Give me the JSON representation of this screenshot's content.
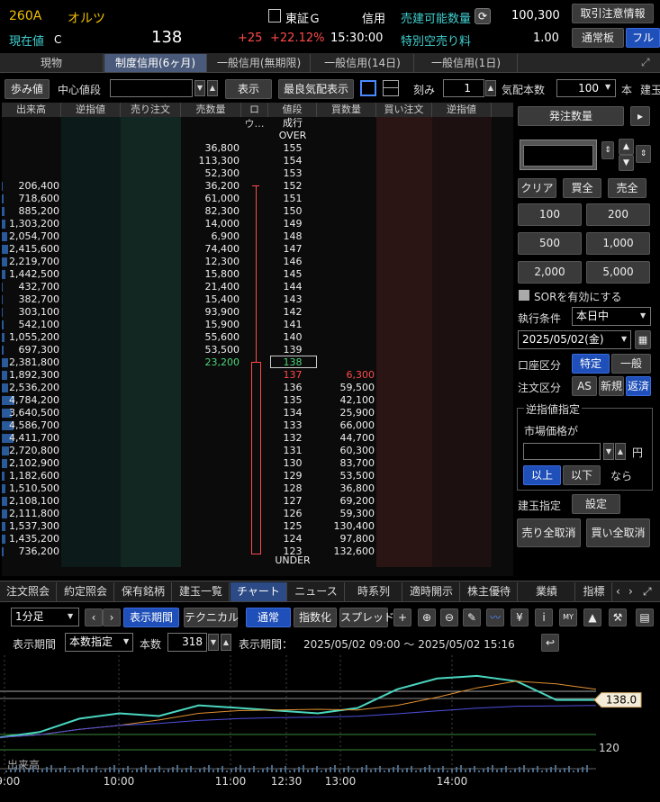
{
  "header": {
    "code": "260A",
    "name": "オルツ",
    "current_label": "現在値",
    "c_mark": "C",
    "price": "138",
    "change": "+25",
    "change_pct": "+22.12%",
    "time": "15:30:00",
    "exchange": "東証Ｇ",
    "credit": "信用",
    "sellable_label": "売建可能数量",
    "sellable_value": "100,300",
    "short_fee_label": "特別空売り料",
    "short_fee_value": "1.00",
    "notice_button": "取引注意情報",
    "normal_button": "通常板",
    "full_button": "フル"
  },
  "top_tabs": [
    "現物",
    "制度信用(6ヶ月)",
    "一般信用(無期限)",
    "一般信用(14日)",
    "一般信用(1日)"
  ],
  "toolbar": {
    "ayumi": "歩み値",
    "center_label": "中心値段",
    "center_value": "",
    "display": "表示",
    "best": "最良気配表示",
    "tick_label": "刻み",
    "tick_value": "1",
    "quote_label": "気配本数",
    "quote_value": "100",
    "unit": "本",
    "build": "建玉"
  },
  "board": {
    "headers": [
      "出来高",
      "逆指値",
      "売り注文",
      "売数量",
      "ロウ…",
      "値段",
      "買数量",
      "買い注文",
      "逆指値"
    ],
    "top_labels": [
      "成行",
      "OVER"
    ],
    "bottom_label": "UNDER",
    "rows": [
      {
        "vol": "",
        "ask": "36,800",
        "price": "155",
        "bid": ""
      },
      {
        "vol": "",
        "ask": "113,300",
        "price": "154",
        "bid": ""
      },
      {
        "vol": "",
        "ask": "52,300",
        "price": "153",
        "bid": ""
      },
      {
        "vol": "206,400",
        "ask": "36,200",
        "price": "152",
        "bid": ""
      },
      {
        "vol": "718,600",
        "ask": "61,000",
        "price": "151",
        "bid": ""
      },
      {
        "vol": "885,200",
        "ask": "82,300",
        "price": "150",
        "bid": ""
      },
      {
        "vol": "1,303,200",
        "ask": "14,000",
        "price": "149",
        "bid": ""
      },
      {
        "vol": "2,054,700",
        "ask": "6,900",
        "price": "148",
        "bid": ""
      },
      {
        "vol": "2,415,600",
        "ask": "74,400",
        "price": "147",
        "bid": ""
      },
      {
        "vol": "2,219,700",
        "ask": "12,300",
        "price": "146",
        "bid": ""
      },
      {
        "vol": "1,442,500",
        "ask": "15,800",
        "price": "145",
        "bid": ""
      },
      {
        "vol": "432,700",
        "ask": "21,400",
        "price": "144",
        "bid": ""
      },
      {
        "vol": "382,700",
        "ask": "15,400",
        "price": "143",
        "bid": ""
      },
      {
        "vol": "303,100",
        "ask": "93,900",
        "price": "142",
        "bid": ""
      },
      {
        "vol": "542,100",
        "ask": "15,900",
        "price": "141",
        "bid": ""
      },
      {
        "vol": "1,055,200",
        "ask": "55,600",
        "price": "140",
        "bid": ""
      },
      {
        "vol": "697,300",
        "ask": "53,500",
        "price": "139",
        "bid": ""
      },
      {
        "vol": "2,381,800",
        "ask": "23,200",
        "price": "138",
        "bid": ""
      },
      {
        "vol": "1,892,300",
        "ask": "",
        "price": "137",
        "bid": "6,300"
      },
      {
        "vol": "2,536,200",
        "ask": "",
        "price": "136",
        "bid": "59,500"
      },
      {
        "vol": "4,784,200",
        "ask": "",
        "price": "135",
        "bid": "42,100"
      },
      {
        "vol": "3,640,500",
        "ask": "",
        "price": "134",
        "bid": "25,900"
      },
      {
        "vol": "4,586,700",
        "ask": "",
        "price": "133",
        "bid": "66,000"
      },
      {
        "vol": "4,411,700",
        "ask": "",
        "price": "132",
        "bid": "44,700"
      },
      {
        "vol": "2,720,800",
        "ask": "",
        "price": "131",
        "bid": "60,300"
      },
      {
        "vol": "2,102,900",
        "ask": "",
        "price": "130",
        "bid": "83,700"
      },
      {
        "vol": "1,182,600",
        "ask": "",
        "price": "129",
        "bid": "53,500"
      },
      {
        "vol": "1,510,500",
        "ask": "",
        "price": "128",
        "bid": "36,800"
      },
      {
        "vol": "2,108,100",
        "ask": "",
        "price": "127",
        "bid": "69,200"
      },
      {
        "vol": "2,111,800",
        "ask": "",
        "price": "126",
        "bid": "59,300"
      },
      {
        "vol": "1,537,300",
        "ask": "",
        "price": "125",
        "bid": "130,400"
      },
      {
        "vol": "1,435,200",
        "ask": "",
        "price": "124",
        "bid": "97,800"
      },
      {
        "vol": "736,200",
        "ask": "",
        "price": "123",
        "bid": "132,600"
      }
    ]
  },
  "order": {
    "qty_label": "発注数量",
    "qty_value": "",
    "clear": "クリア",
    "buy_all": "買全",
    "sell_all": "売全",
    "qty_buttons": [
      "100",
      "200",
      "500",
      "1,000",
      "2,000",
      "5,000"
    ],
    "sor": "SORを有効にする",
    "exec_label": "執行条件",
    "exec_value": "本日中",
    "date_value": "2025/05/02(金)",
    "account_label": "口座区分",
    "account_specific": "特定",
    "account_general": "一般",
    "order_type_label": "注文区分",
    "as": "AS",
    "new": "新規",
    "repay": "返済",
    "stop_title": "逆指値指定",
    "market_label": "市場価格が",
    "stop_value": "",
    "yen": "円",
    "above": "以上",
    "below": "以下",
    "then": "なら",
    "position_label": "建玉指定",
    "setting": "設定",
    "cancel_sell": "売り全取消",
    "cancel_buy": "買い全取消"
  },
  "bottom_tabs": [
    "注文照会",
    "約定照会",
    "保有銘柄",
    "建玉一覧",
    "チャート",
    "ニュース",
    "時系列",
    "適時開示",
    "株主優待",
    "業績",
    "指標"
  ],
  "chart_toolbar": {
    "interval": "1分足",
    "period_btn": "表示期間",
    "technical": "テクニカル",
    "normal": "通常",
    "index": "指数化",
    "spread": "スプレッド",
    "period_label": "表示期間",
    "period_mode": "本数指定",
    "count_label": "本数",
    "count_value": "318",
    "range_label": "表示期間：",
    "range_value": "2025/05/02 09:00 ～ 2025/05/02 15:16"
  },
  "chart_data": {
    "type": "line",
    "x": [
      "09:00",
      "10:00",
      "11:00",
      "12:30",
      "13:00",
      "14:00"
    ],
    "y_labels": [
      "120"
    ],
    "last_price_label": "138.0",
    "volume_label": "出来高",
    "series": [
      {
        "values": [
          124,
          126,
          131,
          133,
          132,
          136,
          135,
          134,
          133,
          135,
          142,
          146,
          147,
          145,
          138,
          138
        ]
      }
    ]
  }
}
